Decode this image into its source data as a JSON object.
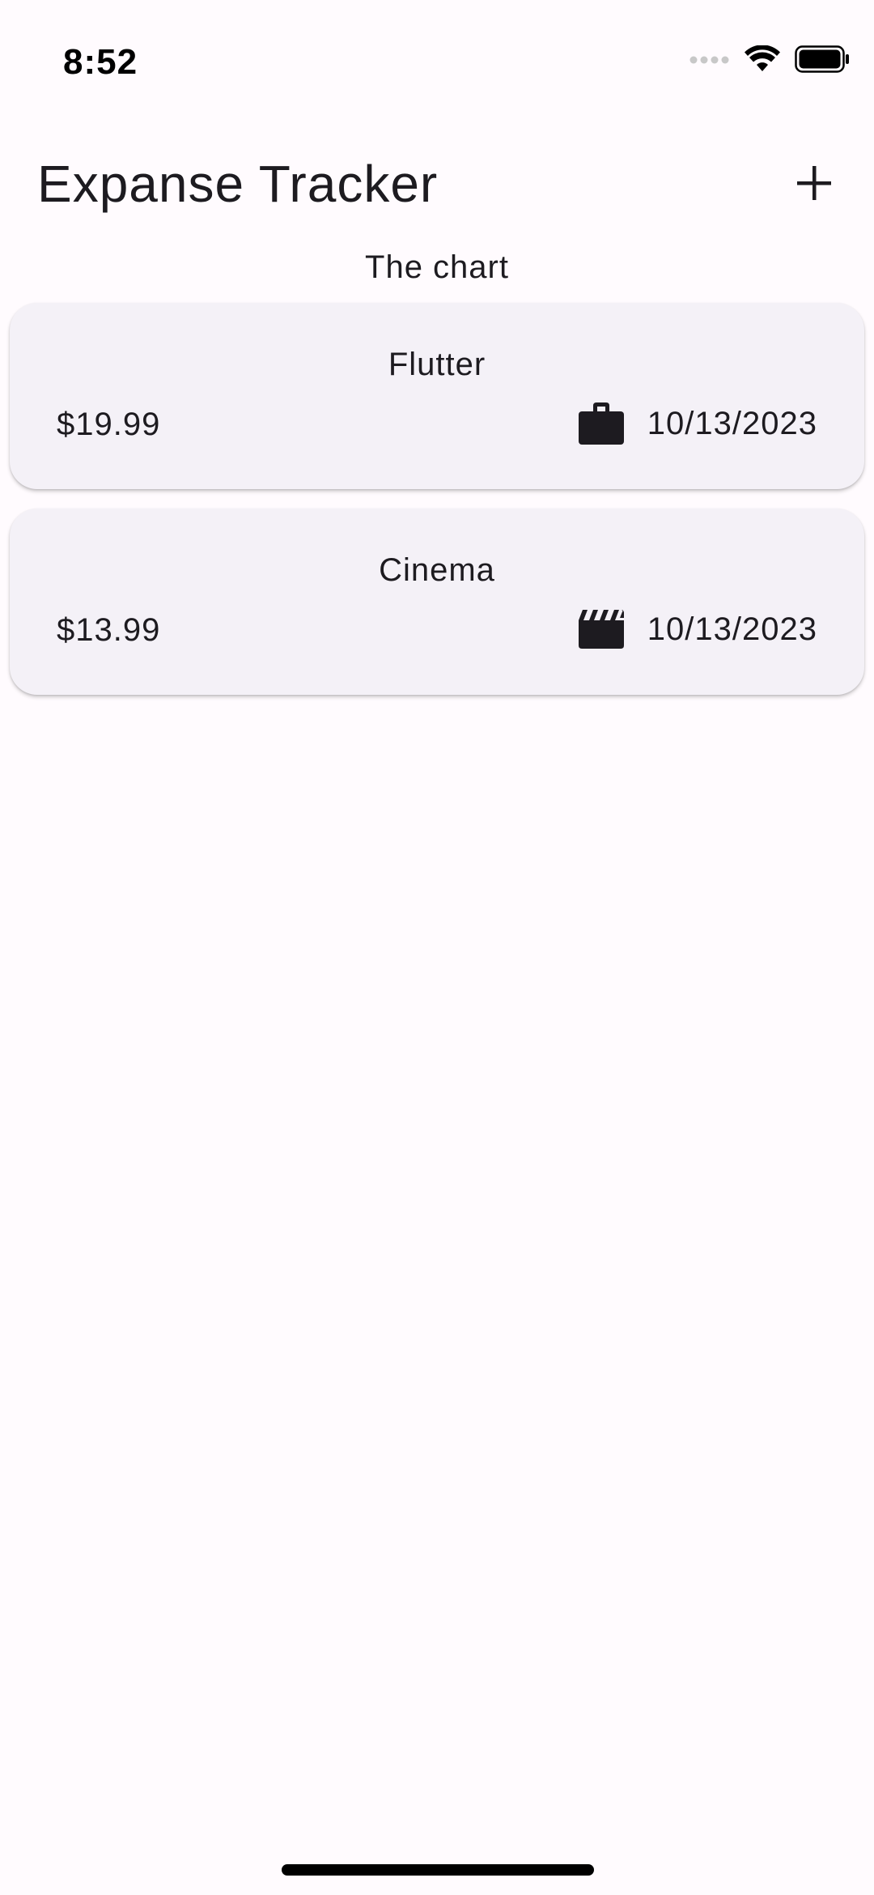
{
  "status_bar": {
    "time": "8:52",
    "icons": [
      "cellular-signal-icon",
      "wifi-icon",
      "battery-icon"
    ]
  },
  "app_bar": {
    "title": "Expanse Tracker",
    "add_icon": "plus-icon"
  },
  "chart": {
    "label": "The chart"
  },
  "expenses": [
    {
      "title": "Flutter",
      "amount": "$19.99",
      "category_icon": "work-briefcase-icon",
      "date": "10/13/2023"
    },
    {
      "title": "Cinema",
      "amount": "$13.99",
      "category_icon": "movie-clapperboard-icon",
      "date": "10/13/2023"
    }
  ],
  "colors": {
    "background": "#fffbfe",
    "card": "#f4f1f7",
    "text": "#1d1b20"
  }
}
